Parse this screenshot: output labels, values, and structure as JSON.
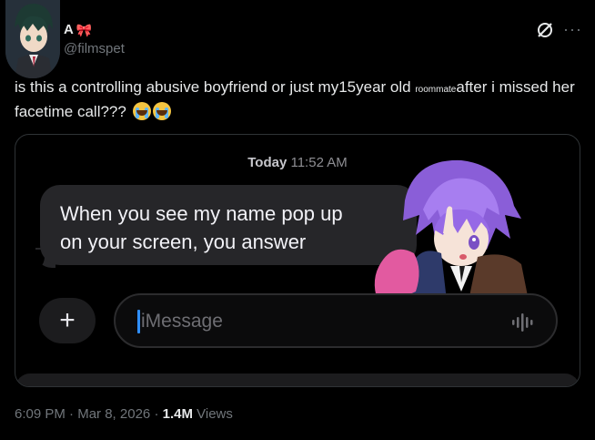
{
  "author": {
    "display_name": "A",
    "handle": "@filmspet"
  },
  "tweet": {
    "text_part1": "is this a controlling abusive boyfriend or just my15year old",
    "text_small": "roommate",
    "text_part2": "after i missed her facetime call???"
  },
  "media": {
    "timestamp_day": "Today",
    "timestamp_time": "11:52 AM",
    "message_line1": "When you see my name pop up",
    "message_line2": "on your screen, you answer",
    "input_placeholder": "iMessage",
    "plus_label": "+"
  },
  "footer": {
    "time": "6:09 PM",
    "separator1": "·",
    "date": "Mar 8, 2026",
    "separator2": "·",
    "views_count": "1.4M",
    "views_label": "Views"
  },
  "icons": {
    "more": "more-icon",
    "grok": "grok-icon",
    "bow": "bow-icon",
    "emoji": "loudly-crying-face-emoji"
  },
  "colors": {
    "background": "#000000",
    "bubble": "#262629",
    "caret": "#2f8fff",
    "secondary_text": "#71767b"
  }
}
